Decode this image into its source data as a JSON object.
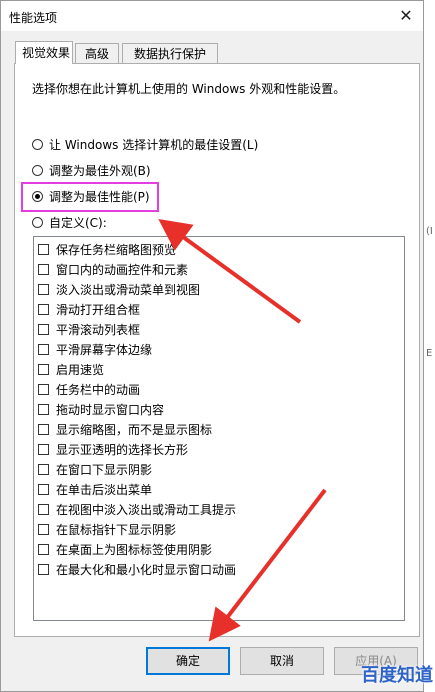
{
  "window": {
    "title": "性能选项",
    "close_glyph": "✕"
  },
  "tabs": [
    {
      "label": "视觉效果",
      "active": true
    },
    {
      "label": "高级",
      "active": false
    },
    {
      "label": "数据执行保护",
      "active": false
    }
  ],
  "description": "选择你想在此计算机上使用的 Windows 外观和性能设置。",
  "radios": [
    {
      "label": "让 Windows 选择计算机的最佳设置(L)",
      "checked": false
    },
    {
      "label": "调整为最佳外观(B)",
      "checked": false
    },
    {
      "label": "调整为最佳性能(P)",
      "checked": true
    },
    {
      "label": "自定义(C):",
      "checked": false
    }
  ],
  "effects": [
    "保存任务栏缩略图预览",
    "窗口内的动画控件和元素",
    "淡入淡出或滑动菜单到视图",
    "滑动打开组合框",
    "平滑滚动列表框",
    "平滑屏幕字体边缘",
    "启用速览",
    "任务栏中的动画",
    "拖动时显示窗口内容",
    "显示缩略图，而不是显示图标",
    "显示亚透明的选择长方形",
    "在窗口下显示阴影",
    "在单击后淡出菜单",
    "在视图中淡入淡出或滑动工具提示",
    "在鼠标指针下显示阴影",
    "在桌面上为图标标签使用阴影",
    "在最大化和最小化时显示窗口动画"
  ],
  "buttons": {
    "ok": "确定",
    "cancel": "取消",
    "apply": "应用(A)"
  },
  "background_fragments": [
    "(I",
    "E"
  ],
  "watermark": "百度知道",
  "annotation_color": "#e8302a",
  "highlight_color": "#e43ee3"
}
